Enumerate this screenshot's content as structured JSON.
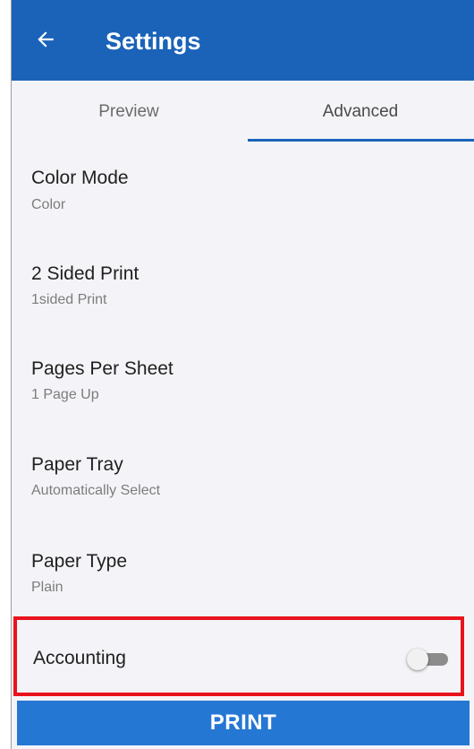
{
  "header": {
    "title": "Settings",
    "back_icon": "arrow-left-icon"
  },
  "tabs": [
    {
      "label": "Preview",
      "selected": false
    },
    {
      "label": "Advanced",
      "selected": true
    }
  ],
  "settings": [
    {
      "label": "Color Mode",
      "value": "Color"
    },
    {
      "label": "2 Sided Print",
      "value": "1sided Print"
    },
    {
      "label": "Pages Per Sheet",
      "value": "1 Page Up"
    },
    {
      "label": "Paper Tray",
      "value": "Automatically Select"
    },
    {
      "label": "Paper Type",
      "value": "Plain"
    }
  ],
  "accounting": {
    "label": "Accounting",
    "enabled": false
  },
  "print_button": {
    "label": "PRINT"
  },
  "colors": {
    "app_bar": "#1a63b9",
    "print_button": "#2577d4",
    "highlight_border": "#e8131c",
    "background": "#f4f4f8"
  }
}
